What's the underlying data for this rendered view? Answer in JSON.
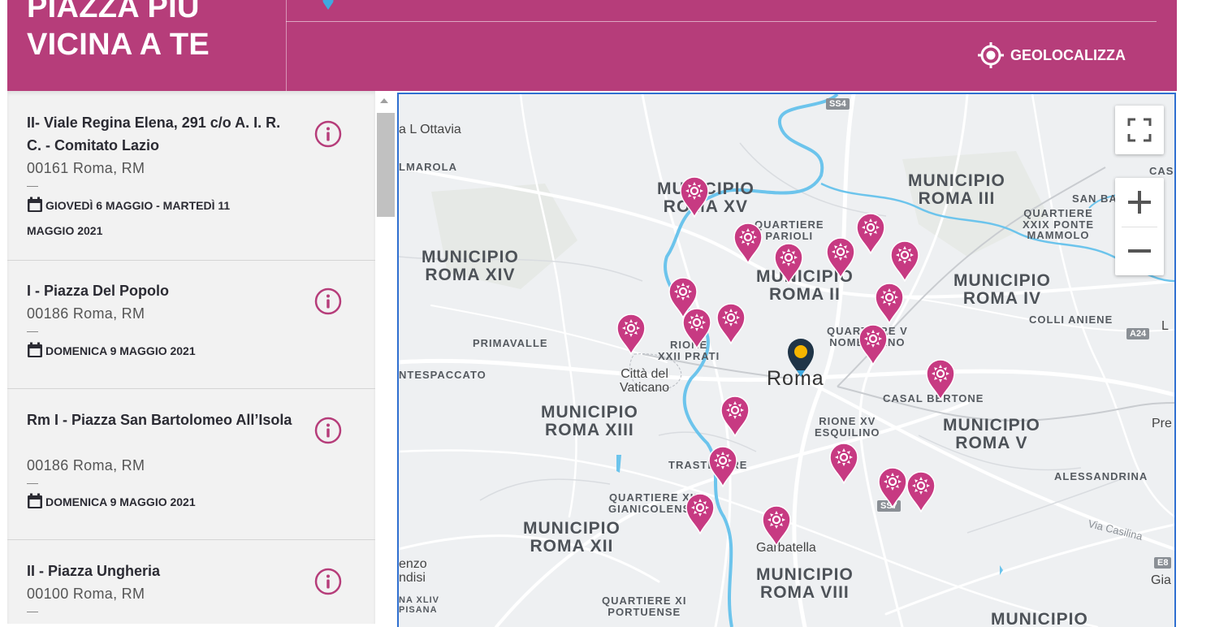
{
  "header": {
    "title_line1": "PIAZZA PIÙ",
    "title_line2": "VICINA A TE",
    "geolocate_label": "GEOLOCALIZZA",
    "bg_color": "#b63d7a"
  },
  "locations": [
    {
      "name": "II- Viale Regina Elena, 291 c/o A. I. R. C.  - Comitato Lazio",
      "address": "00161 Roma, RM",
      "date": "GIOVEDÌ 6 MAGGIO - MARTEDÌ 11 MAGGIO 2021"
    },
    {
      "name": "I - Piazza Del Popolo",
      "address": "00186 Roma, RM",
      "date": "DOMENICA 9 MAGGIO 2021"
    },
    {
      "name": "Rm I - Piazza San Bartolomeo All’Isola",
      "address": "00186 Roma, RM",
      "date": "DOMENICA 9 MAGGIO 2021"
    },
    {
      "name": "II - Piazza Ungheria",
      "address": "00100 Roma, RM",
      "date": ""
    }
  ],
  "map": {
    "city_label": "Roma",
    "labels": {
      "xv": "MUNICIPIO\nROMA XV",
      "iii": "MUNICIPIO\nROMA III",
      "xiv": "MUNICIPIO\nROMA XIV",
      "ii": "MUNICIPIO\nROMA II",
      "iv": "MUNICIPIO\nROMA IV",
      "xiii": "MUNICIPIO\nROMA XIII",
      "v": "MUNICIPIO\nROMA V",
      "xii": "MUNICIPIO\nROMA XII",
      "viii": "MUNICIPIO\nROMA VIII",
      "vii_partial": "MUNICIPIO",
      "ottavia": "a L Ottavia",
      "marola": "LMAROLA",
      "parioli": "QUARTIERE\nPARIOLI",
      "san_ba": "SAN BA",
      "ponte_mammolo": "QUARTIERE\nXXIX PONTE\nMAMMOLO",
      "cas": "CAS",
      "primavalle": "PRIMAVALLE",
      "prati": "RIONE\nXXII PRATI",
      "nomentano": "QUARTIERE V\nNOMENTANO",
      "colli_aniene": "COLLI ANIENE",
      "l_edge": "L",
      "tespaccato": "NTESPACCATO",
      "vaticano": "Città del\nVaticano",
      "casal_bertone": "CASAL BERTONE",
      "esquilino": "RIONE XV\nESQUILINO",
      "pre": "Pre",
      "trastevere": "TRASTEVERE",
      "alessandrina": "ALESSANDRINA",
      "gianicolense": "QUARTIERE XII\nGIANICOLENSE",
      "garbatella": "Garbatella",
      "via_casilina": "Via Casilina",
      "gia": "Gia",
      "lorenzo": "enzo\nndisi",
      "pisana": "NA XLIV\nPISANA",
      "portuense": "QUARTIERE XI\nPORTUENSE"
    },
    "shields": {
      "ss4": "SS4",
      "a24": "A24",
      "ss7": "SS7",
      "e8": "E8"
    }
  }
}
